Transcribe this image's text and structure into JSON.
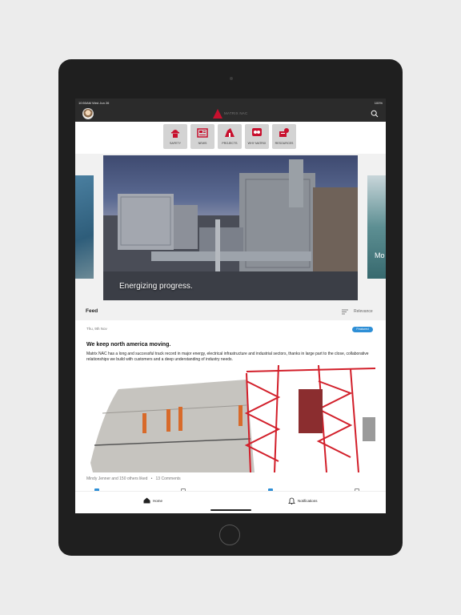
{
  "status_bar": {
    "time": "10:50AM Wed Jun 26",
    "battery": "100%"
  },
  "nav": {
    "logo_text": "MATRIX NAC"
  },
  "categories": [
    {
      "label": "SAFETY",
      "icon": "safety-icon"
    },
    {
      "label": "NEWS",
      "icon": "news-icon"
    },
    {
      "label": "PROJECTS",
      "icon": "projects-icon"
    },
    {
      "label": "WHY MATRIX",
      "icon": "why-matrix-icon"
    },
    {
      "label": "RESOURCES",
      "icon": "resources-icon"
    }
  ],
  "carousel": {
    "main_caption": "Energizing progress.",
    "next_caption": "Mo"
  },
  "feed": {
    "title": "Feed",
    "sort_label": "Relevance"
  },
  "post": {
    "date": "Thu, 9th Nov",
    "badge": "Featured",
    "title": "We keep north america moving.",
    "body": "Matrix NAC has a long and successful track record in major energy, electrical infrastructure and industrial sectors, thanks in large part to the close, collaborative relationships we build with customers and a deep understanding of industry needs.",
    "likes": "Mindy Jenner and 150 others liked",
    "comments": "13 Comments"
  },
  "tabs": {
    "home": "Home",
    "notifications": "Notifications"
  },
  "colors": {
    "accent": "#c8102e",
    "badge": "#2e8fd6",
    "nav_bg": "#2b2b2b"
  }
}
